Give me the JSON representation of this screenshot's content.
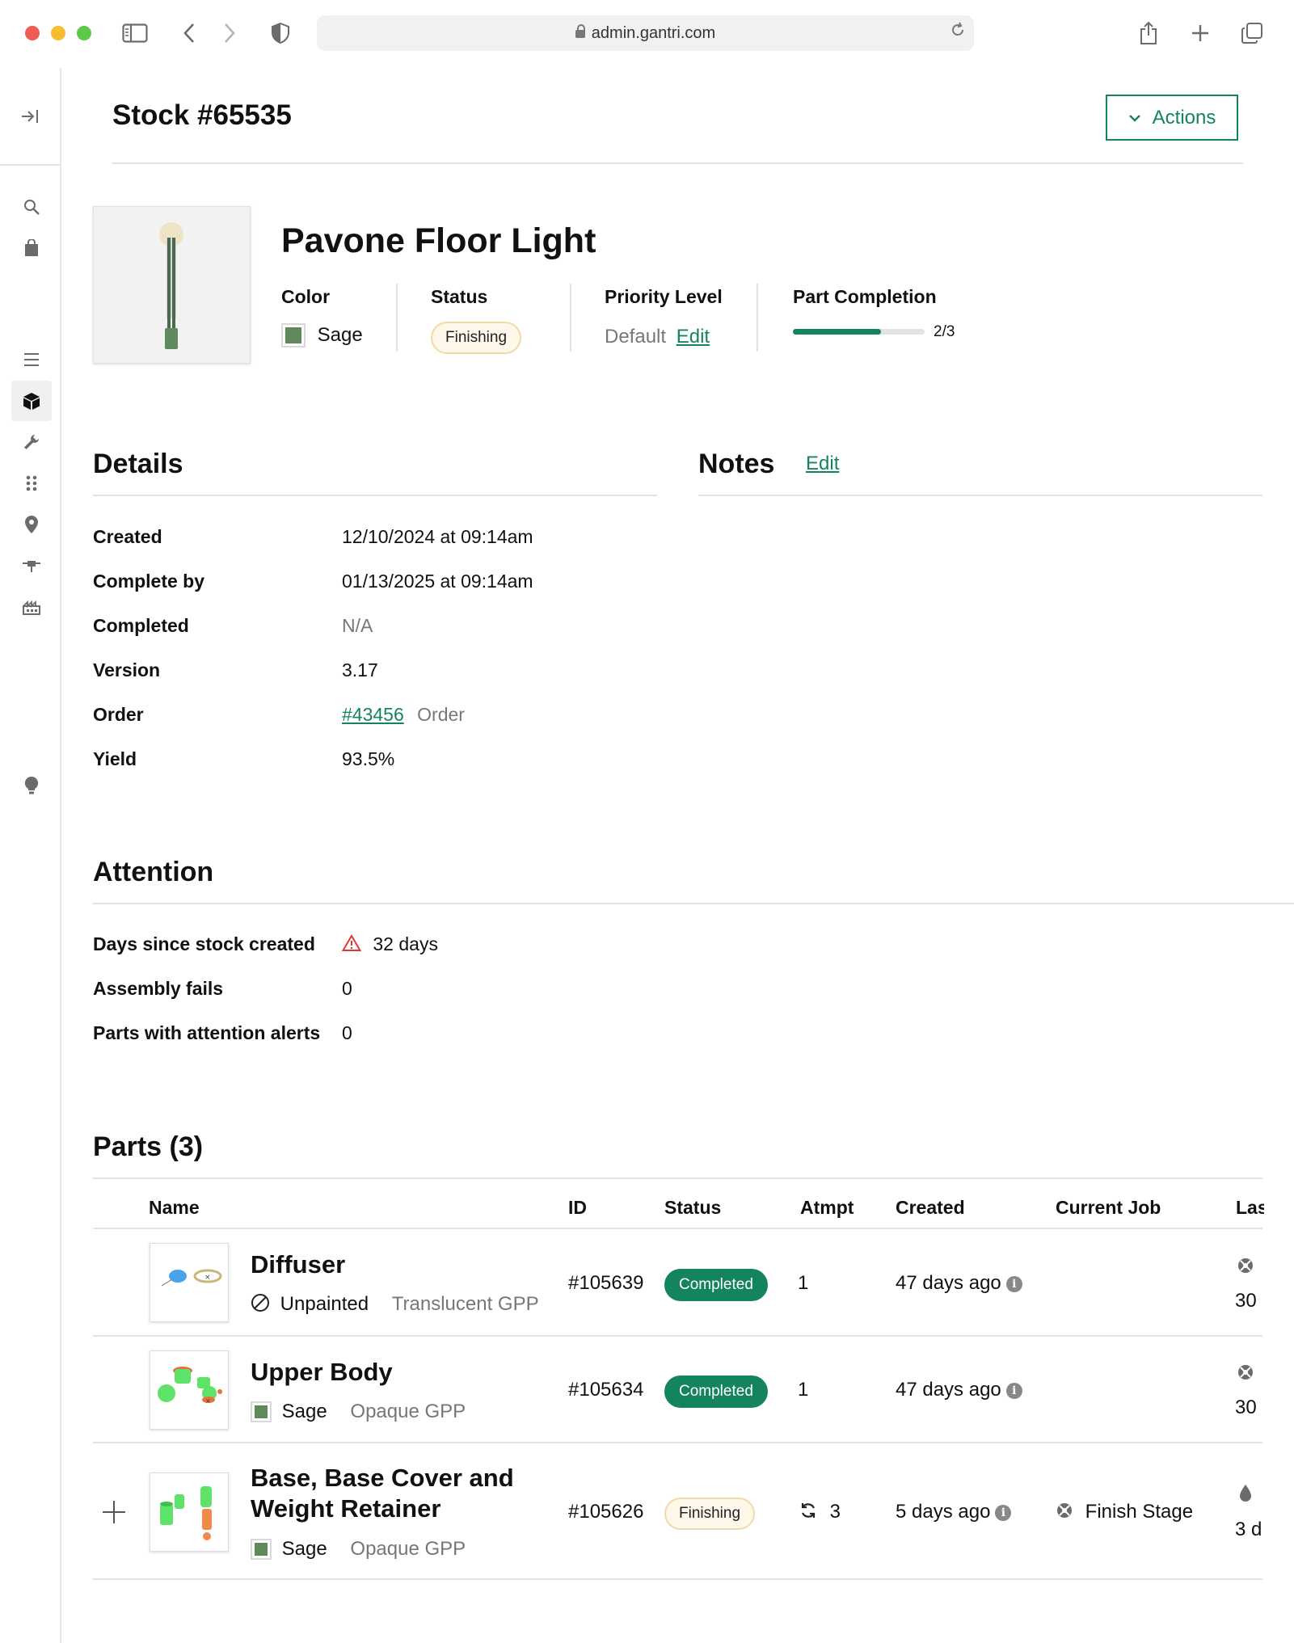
{
  "browser": {
    "url": "admin.gantri.com"
  },
  "page": {
    "title": "Stock #65535",
    "actions_label": "Actions"
  },
  "product": {
    "name": "Pavone Floor Light",
    "color_label": "Color",
    "color_value": "Sage",
    "status_label": "Status",
    "status_value": "Finishing",
    "priority_label": "Priority Level",
    "priority_value": "Default",
    "priority_edit": "Edit",
    "completion_label": "Part Completion",
    "completion_text": "2/3",
    "completion_fraction": 0.6667
  },
  "details": {
    "title": "Details",
    "rows": [
      {
        "label": "Created",
        "value": "12/10/2024 at 09:14am"
      },
      {
        "label": "Complete by",
        "value": "01/13/2025 at 09:14am"
      },
      {
        "label": "Completed",
        "value": "N/A"
      },
      {
        "label": "Version",
        "value": "3.17"
      },
      {
        "label": "Order",
        "value": "#43456",
        "suffix": "Order"
      },
      {
        "label": "Yield",
        "value": "93.5%"
      }
    ]
  },
  "notes": {
    "title": "Notes",
    "edit": "Edit"
  },
  "attention": {
    "title": "Attention",
    "rows": [
      {
        "label": "Days since stock created",
        "value": "32 days"
      },
      {
        "label": "Assembly fails",
        "value": "0"
      },
      {
        "label": "Parts with attention alerts",
        "value": "0"
      }
    ]
  },
  "parts": {
    "title": "Parts (3)",
    "columns": [
      "Name",
      "ID",
      "Status",
      "Atmpt",
      "Created",
      "Current Job",
      "Las"
    ],
    "rows": [
      {
        "name": "Diffuser",
        "name2": "",
        "paint": "Unpainted",
        "material": "Translucent GPP",
        "id": "#105639",
        "status": "Completed",
        "attempt": "1",
        "created": "47 days ago",
        "job": "",
        "last": "30"
      },
      {
        "name": "Upper Body",
        "name2": "",
        "paint": "Sage",
        "material": "Opaque GPP",
        "id": "#105634",
        "status": "Completed",
        "attempt": "1",
        "created": "47 days ago",
        "job": "",
        "last": "30"
      },
      {
        "name": "Base, Base Cover and",
        "name2": "Weight Retainer",
        "paint": "Sage",
        "material": "Opaque GPP",
        "id": "#105626",
        "status": "Finishing",
        "attempt": "3",
        "created": "5 days ago",
        "job": "Finish Stage",
        "last": "3 d"
      }
    ]
  },
  "colors": {
    "accent": "#14845f",
    "sage": "#5f8a5d",
    "finishing_bg": "#fff7ea",
    "warning": "#d93a3a"
  },
  "icons": {
    "sidebar": [
      "collapse-icon",
      "search-icon",
      "bag-icon",
      "menu-icon",
      "box-icon",
      "wrench-icon",
      "grid-dots-icon",
      "location-pin-icon",
      "pin-tool-icon",
      "factory-icon",
      "lightbulb-icon"
    ]
  }
}
